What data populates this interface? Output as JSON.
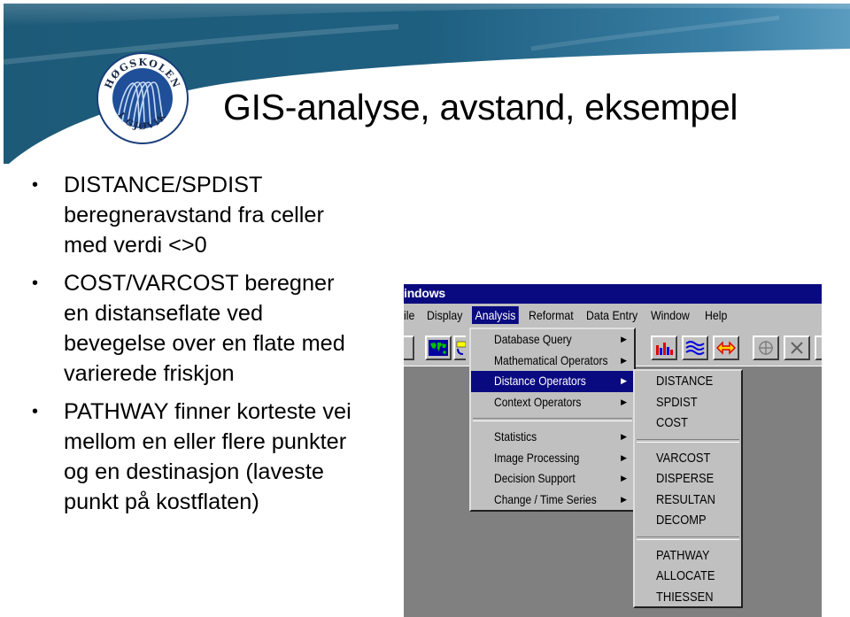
{
  "slide": {
    "title": "GIS-analyse, avstand, eksempel",
    "logo": {
      "top_text": "HØGSKOLEN",
      "bottom_text": "I GJØVIK"
    },
    "bullets": [
      {
        "lines": [
          "DISTANCE/SPDIST",
          "beregneravstand fra celler",
          "med verdi <>0"
        ]
      },
      {
        "lines": [
          "COST/VARCOST beregner",
          "en distanseflate ved",
          "bevegelse over en flate med",
          "varierede friskjon"
        ]
      },
      {
        "lines": [
          "PATHWAY finner korteste vei",
          "mellom en eller flere punkter",
          "og en destinasjon (laveste",
          "punkt på kostflaten)"
        ]
      }
    ]
  },
  "app": {
    "title_fragment": "indows",
    "menubar": [
      {
        "label": "ile",
        "active": false
      },
      {
        "label": "Display",
        "active": false
      },
      {
        "label": "Analysis",
        "active": true
      },
      {
        "label": "Reformat",
        "active": false
      },
      {
        "label": "Data Entry",
        "active": false
      },
      {
        "label": "Window",
        "active": false
      },
      {
        "label": "Help",
        "active": false
      }
    ],
    "toolbar_icons": [
      "world-map-icon",
      "phone-icon",
      "bar-chart-icon",
      "waves-icon",
      "double-arrow-icon",
      "crosshair-icon",
      "tools-icon"
    ],
    "analysis_menu": {
      "groups": [
        [
          "Database Query",
          "Mathematical Operators",
          "Distance Operators",
          "Context Operators"
        ],
        [
          "Statistics",
          "Image Processing",
          "Decision Support",
          "Change / Time Series"
        ]
      ],
      "selected": "Distance Operators"
    },
    "distance_submenu": {
      "groups": [
        [
          "DISTANCE",
          "SPDIST",
          "COST"
        ],
        [
          "VARCOST",
          "DISPERSE",
          "RESULTAN",
          "DECOMP"
        ],
        [
          "PATHWAY",
          "ALLOCATE",
          "THIESSEN"
        ]
      ]
    },
    "colors": {
      "titlebar": "#0a0a80",
      "face": "#c0c0c0",
      "workspace": "#808080"
    }
  }
}
